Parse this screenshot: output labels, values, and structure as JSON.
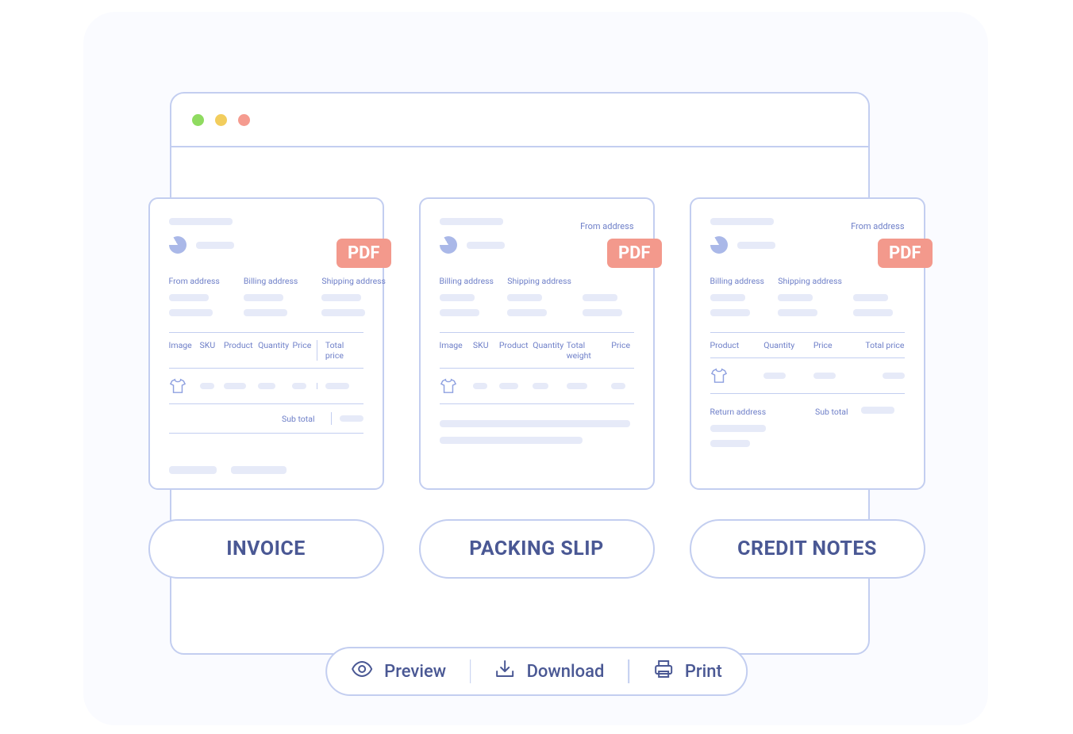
{
  "pdf_badge": "PDF",
  "cards": {
    "invoice": {
      "addresses": [
        "From address",
        "Billing address",
        "Shipping address"
      ],
      "columns": [
        "Image",
        "SKU",
        "Product",
        "Quantity",
        "Price",
        "Total price"
      ],
      "subtotal_label": "Sub total"
    },
    "packing_slip": {
      "top_right_label": "From address",
      "addresses": [
        "Billing address",
        "Shipping address"
      ],
      "columns": [
        "Image",
        "SKU",
        "Product",
        "Quantity",
        "Total weight",
        "Price"
      ]
    },
    "credit_notes": {
      "top_right_label": "From address",
      "addresses": [
        "Billing address",
        "Shipping address"
      ],
      "columns": [
        "Product",
        "Quantity",
        "Price",
        "Total price"
      ],
      "return_label": "Return address",
      "subtotal_label": "Sub total"
    }
  },
  "pills": {
    "invoice": "INVOICE",
    "packing_slip": "PACKING SLIP",
    "credit_notes": "CREDIT NOTES"
  },
  "actions": {
    "preview": "Preview",
    "download": "Download",
    "print": "Print"
  }
}
